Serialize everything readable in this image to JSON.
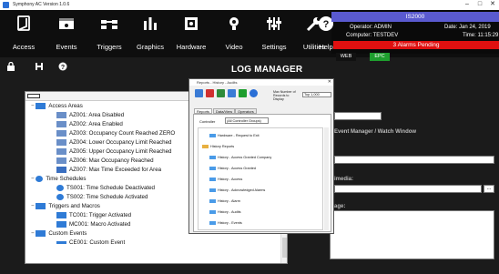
{
  "window": {
    "title": "Symphony AC Version 1.0.6"
  },
  "nav": [
    {
      "label": "Access",
      "icon": "access-icon"
    },
    {
      "label": "Events",
      "icon": "events-icon"
    },
    {
      "label": "Triggers",
      "icon": "triggers-icon"
    },
    {
      "label": "Graphics",
      "icon": "graphics-icon"
    },
    {
      "label": "Hardware",
      "icon": "hardware-icon"
    },
    {
      "label": "Video",
      "icon": "video-icon"
    },
    {
      "label": "Settings",
      "icon": "settings-icon"
    },
    {
      "label": "Utilities",
      "icon": "utilities-icon"
    },
    {
      "label": "Help",
      "icon": "help-icon"
    }
  ],
  "status": {
    "server": "IS2000",
    "operator": "Operator: ADMIN",
    "computer": "Computer: TESTDEV",
    "date": "Date: Jan 24, 2019",
    "time": "Time: 11:15:29",
    "alarms": "3 Alarms Pending",
    "web_badge": "WEB",
    "epc_badge": "EPC",
    "colors": {
      "header": "#5a5ad0",
      "alarm": "#e01010",
      "epc": "#1e9e2e"
    }
  },
  "page_title": "LOG MANAGER",
  "tree": {
    "groups": [
      {
        "label": "Access Areas",
        "items": [
          "AZ001: Area Disabled",
          "AZ002: Area Enabled",
          "AZ003: Occupancy Count Reached ZERO",
          "AZ004: Lower Occupancy Limit Reached",
          "AZ005: Upper Occupancy Limit Reached",
          "AZ006: Max Occupancy Reached",
          "AZ007: Max Time Exceeded for Area"
        ]
      },
      {
        "label": "Time Schedules",
        "items": [
          "TS001: Time Schedule Deactivated",
          "TS002: Time Schedule Activated"
        ]
      },
      {
        "label": "Triggers and Macros",
        "items": [
          "TC001: Trigger Activated",
          "MC001: Macro Activated"
        ]
      },
      {
        "label": "Custom Events",
        "items": [
          "CE001: Custom Event"
        ]
      }
    ]
  },
  "right_panel": {
    "event_manager_label": "Event Manager / Watch Window",
    "multimedia_label": "imedia:",
    "message_label": "age:",
    "browse_label": "..."
  },
  "dialog": {
    "title": "Reports - History - Audits",
    "max_label": "Max Number of Records to Display",
    "max_value": "Top 1,000",
    "tabs": [
      "Reports",
      "Data/View",
      "Operators"
    ],
    "controller_label": "Controller",
    "controller_value": "(All Controller Groups)",
    "rows": [
      {
        "label": "Hardware - Request to Exit",
        "indent": 2
      },
      {
        "label": "History Reports",
        "indent": 0
      },
      {
        "label": "History - Access Granted Company",
        "indent": 2
      },
      {
        "label": "History - Access Granted",
        "indent": 2
      },
      {
        "label": "History - Access",
        "indent": 2
      },
      {
        "label": "History - Acknowledged Alarms",
        "indent": 2
      },
      {
        "label": "History - Alarm",
        "indent": 2
      },
      {
        "label": "History - Audits",
        "indent": 2
      },
      {
        "label": "History - Events",
        "indent": 2
      }
    ]
  }
}
